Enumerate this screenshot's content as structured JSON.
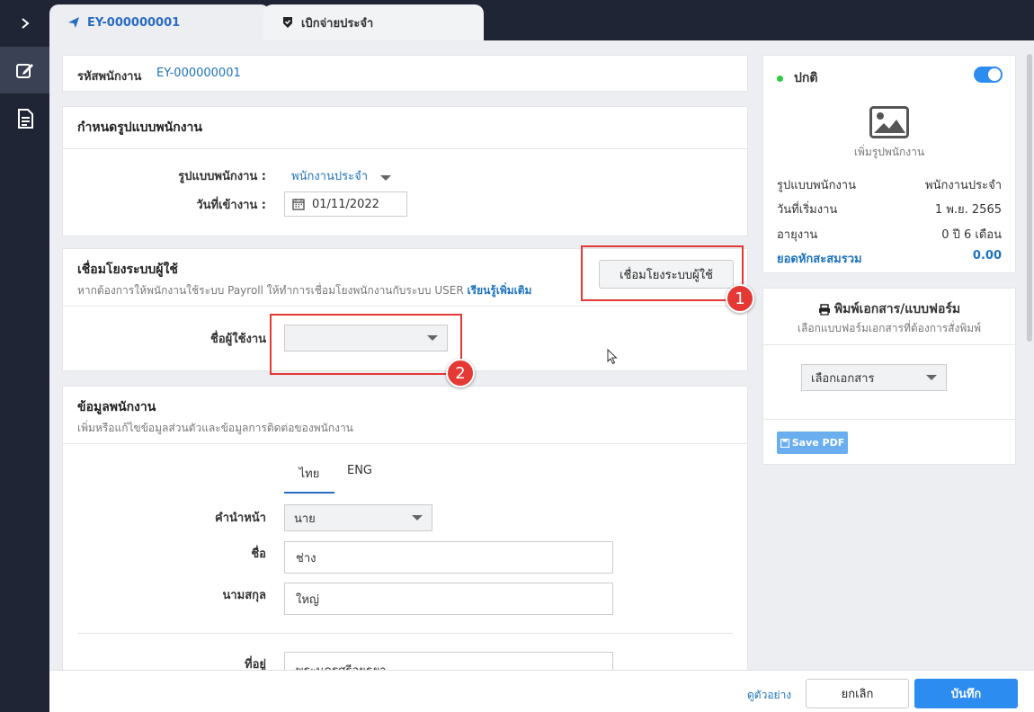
{
  "tabs": [
    {
      "label": "EY-000000001",
      "icon": "paper-plane-icon"
    },
    {
      "label": "เบิกจ่ายประจำ",
      "icon": "shield-icon"
    }
  ],
  "employee_code": {
    "label": "รหัสพนักงาน",
    "value": "EY-000000001"
  },
  "employee_type_section": {
    "title": "กำหนดรูปแบบพนักงาน",
    "type_label": "รูปแบบพนักงาน :",
    "type_value": "พนักงานประจำ",
    "start_label": "วันที่เข้างาน :",
    "start_value": "01/11/2022"
  },
  "user_link_section": {
    "title": "เชื่อมโยงระบบผู้ใช้",
    "subtitle": "หากต้องการให้พนักงานใช้ระบบ Payroll ให้ทำการเชื่อมโยงพนักงานกับระบบ USER",
    "learn_more": "เรียนรู้เพิ่มเติม",
    "button_label": "เชื่อมโยงระบบผู้ใช้",
    "username_label": "ชื่อผู้ใช้งาน",
    "username_value": ""
  },
  "annotations": [
    "1",
    "2"
  ],
  "employee_info_section": {
    "title": "ข้อมูลพนักงาน",
    "subtitle": "เพิ่มหรือแก้ไขข้อมูลส่วนตัวและข้อมูลการติดต่อของพนักงาน",
    "lang_tabs": [
      "ไทย",
      "ENG"
    ],
    "prefix_label": "คำนำหน้า",
    "prefix_value": "นาย",
    "name_label": "ชื่อ",
    "name_value": "ช่าง",
    "surname_label": "นามสกุล",
    "surname_value": "ใหญ่",
    "address_label": "ที่อยู่",
    "address_value": "พระนครศรีอยุธยา"
  },
  "status_card": {
    "status_label": "ปกติ",
    "photo_label": "เพิ่มรูปพนักงาน",
    "rows": [
      {
        "label": "รูปแบบพนักงาน",
        "value": "พนักงานประจำ"
      },
      {
        "label": "วันที่เริ่มงาน",
        "value": "1 พ.ย. 2565"
      },
      {
        "label": "อายุงาน",
        "value": "0 ปี 6 เดือน"
      }
    ],
    "total_label": "ยอดหักสะสมรวม",
    "total_value": "0.00"
  },
  "print_card": {
    "title": "พิมพ์เอกสาร/แบบฟอร์ม",
    "subtitle": "เลือกแบบฟอร์มเอกสารที่ต้องการสั่งพิมพ์",
    "select_value": "เลือกเอกสาร",
    "save_pdf": "Save PDF"
  },
  "footer": {
    "preview": "ดูตัวอย่าง",
    "cancel": "ยกเลิก",
    "save": "บันทึก"
  },
  "colors": {
    "accent": "#2d8cf0",
    "sidebar": "#1f2535",
    "annotation": "#e53935",
    "status": "#2ecc40"
  }
}
